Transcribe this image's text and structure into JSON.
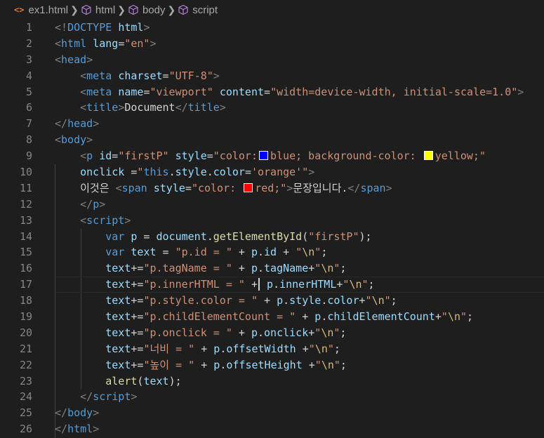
{
  "breadcrumb": {
    "file_icon": "<>",
    "file": "ex1.html",
    "items": [
      "html",
      "body",
      "script"
    ]
  },
  "editor": {
    "language": "html",
    "cursor_line": 17,
    "lines": [
      {
        "n": "1",
        "tokens": [
          [
            "punct",
            "<!"
          ],
          [
            "tag",
            "DOCTYPE"
          ],
          [
            "text",
            " "
          ],
          [
            "attr",
            "html"
          ],
          [
            "punct",
            ">"
          ]
        ]
      },
      {
        "n": "2",
        "tokens": [
          [
            "punct",
            "<"
          ],
          [
            "tag",
            "html"
          ],
          [
            "text",
            " "
          ],
          [
            "attr",
            "lang"
          ],
          [
            "text",
            "="
          ],
          [
            "str",
            "\"en\""
          ],
          [
            "punct",
            ">"
          ]
        ]
      },
      {
        "n": "3",
        "tokens": [
          [
            "punct",
            "<"
          ],
          [
            "tag",
            "head"
          ],
          [
            "punct",
            ">"
          ]
        ]
      },
      {
        "n": "4",
        "tokens": [
          [
            "text",
            "    "
          ],
          [
            "punct",
            "<"
          ],
          [
            "tag",
            "meta"
          ],
          [
            "text",
            " "
          ],
          [
            "attr",
            "charset"
          ],
          [
            "text",
            "="
          ],
          [
            "str",
            "\"UTF-8\""
          ],
          [
            "punct",
            ">"
          ]
        ]
      },
      {
        "n": "5",
        "tokens": [
          [
            "text",
            "    "
          ],
          [
            "punct",
            "<"
          ],
          [
            "tag",
            "meta"
          ],
          [
            "text",
            " "
          ],
          [
            "attr",
            "name"
          ],
          [
            "text",
            "="
          ],
          [
            "str",
            "\"viewport\""
          ],
          [
            "text",
            " "
          ],
          [
            "attr",
            "content"
          ],
          [
            "text",
            "="
          ],
          [
            "str",
            "\"width=device-width, initial-scale=1.0\""
          ],
          [
            "punct",
            ">"
          ]
        ]
      },
      {
        "n": "6",
        "tokens": [
          [
            "text",
            "    "
          ],
          [
            "punct",
            "<"
          ],
          [
            "tag",
            "title"
          ],
          [
            "punct",
            ">"
          ],
          [
            "text",
            "Document"
          ],
          [
            "punct",
            "</"
          ],
          [
            "tag",
            "title"
          ],
          [
            "punct",
            ">"
          ]
        ]
      },
      {
        "n": "7",
        "tokens": [
          [
            "punct",
            "</"
          ],
          [
            "tag",
            "head"
          ],
          [
            "punct",
            ">"
          ]
        ]
      },
      {
        "n": "8",
        "tokens": [
          [
            "punct",
            "<"
          ],
          [
            "tag",
            "body"
          ],
          [
            "punct",
            ">"
          ]
        ]
      },
      {
        "n": "9",
        "tokens": [
          [
            "text",
            "    "
          ],
          [
            "punct",
            "<"
          ],
          [
            "tag",
            "p"
          ],
          [
            "text",
            " "
          ],
          [
            "attr",
            "id"
          ],
          [
            "text",
            "="
          ],
          [
            "str",
            "\"firstP\""
          ],
          [
            "text",
            " "
          ],
          [
            "attr",
            "style"
          ],
          [
            "text",
            "="
          ],
          [
            "str",
            "\"color:"
          ],
          [
            "swatch",
            "#0000ff"
          ],
          [
            "str",
            "blue; background-color: "
          ],
          [
            "swatch",
            "#ffff00"
          ],
          [
            "str",
            "yellow;\""
          ]
        ]
      },
      {
        "n": "10",
        "tokens": [
          [
            "text",
            "    "
          ],
          [
            "attr",
            "onclick"
          ],
          [
            "text",
            " ="
          ],
          [
            "str",
            "\""
          ],
          [
            "kw",
            "this"
          ],
          [
            "text",
            "."
          ],
          [
            "var",
            "style"
          ],
          [
            "text",
            "."
          ],
          [
            "var",
            "color"
          ],
          [
            "text",
            "="
          ],
          [
            "str",
            "'orange'"
          ],
          [
            "str",
            "\""
          ],
          [
            "punct",
            ">"
          ]
        ]
      },
      {
        "n": "11",
        "tokens": [
          [
            "text",
            "    이것은 "
          ],
          [
            "punct",
            "<"
          ],
          [
            "tag",
            "span"
          ],
          [
            "text",
            " "
          ],
          [
            "attr",
            "style"
          ],
          [
            "text",
            "="
          ],
          [
            "str",
            "\"color: "
          ],
          [
            "swatch",
            "#ff0000"
          ],
          [
            "str",
            "red;\""
          ],
          [
            "punct",
            ">"
          ],
          [
            "text",
            "문장입니다."
          ],
          [
            "punct",
            "</"
          ],
          [
            "tag",
            "span"
          ],
          [
            "punct",
            ">"
          ]
        ]
      },
      {
        "n": "12",
        "tokens": [
          [
            "text",
            "    "
          ],
          [
            "punct",
            "</"
          ],
          [
            "tag",
            "p"
          ],
          [
            "punct",
            ">"
          ]
        ]
      },
      {
        "n": "13",
        "tokens": [
          [
            "text",
            "    "
          ],
          [
            "punct",
            "<"
          ],
          [
            "tag",
            "script"
          ],
          [
            "punct",
            ">"
          ]
        ]
      },
      {
        "n": "14",
        "tokens": [
          [
            "text",
            "        "
          ],
          [
            "kw",
            "var"
          ],
          [
            "text",
            " "
          ],
          [
            "var",
            "p"
          ],
          [
            "text",
            " = "
          ],
          [
            "var",
            "document"
          ],
          [
            "text",
            "."
          ],
          [
            "fn",
            "getElementById"
          ],
          [
            "text",
            "("
          ],
          [
            "str",
            "\"firstP\""
          ],
          [
            "text",
            ");"
          ]
        ]
      },
      {
        "n": "15",
        "tokens": [
          [
            "text",
            "        "
          ],
          [
            "kw",
            "var"
          ],
          [
            "text",
            " "
          ],
          [
            "var",
            "text"
          ],
          [
            "text",
            " = "
          ],
          [
            "str",
            "\"p.id = \""
          ],
          [
            "text",
            " + "
          ],
          [
            "var",
            "p"
          ],
          [
            "text",
            "."
          ],
          [
            "var",
            "id"
          ],
          [
            "text",
            " + "
          ],
          [
            "str",
            "\""
          ],
          [
            "esc",
            "\\n"
          ],
          [
            "str",
            "\""
          ],
          [
            "text",
            ";"
          ]
        ]
      },
      {
        "n": "16",
        "tokens": [
          [
            "text",
            "        "
          ],
          [
            "var",
            "text"
          ],
          [
            "text",
            "+="
          ],
          [
            "str",
            "\"p.tagName = \""
          ],
          [
            "text",
            " + "
          ],
          [
            "var",
            "p"
          ],
          [
            "text",
            "."
          ],
          [
            "var",
            "tagName"
          ],
          [
            "text",
            "+"
          ],
          [
            "str",
            "\""
          ],
          [
            "esc",
            "\\n"
          ],
          [
            "str",
            "\""
          ],
          [
            "text",
            ";"
          ]
        ]
      },
      {
        "n": "17",
        "tokens": [
          [
            "text",
            "        "
          ],
          [
            "var",
            "text"
          ],
          [
            "text",
            "+="
          ],
          [
            "str",
            "\"p.innerHTML = \""
          ],
          [
            "text",
            " +"
          ],
          [
            "cursor",
            ""
          ],
          [
            "text",
            " "
          ],
          [
            "var",
            "p"
          ],
          [
            "text",
            "."
          ],
          [
            "var",
            "innerHTML"
          ],
          [
            "text",
            "+"
          ],
          [
            "str",
            "\""
          ],
          [
            "esc",
            "\\n"
          ],
          [
            "str",
            "\""
          ],
          [
            "text",
            ";"
          ]
        ]
      },
      {
        "n": "18",
        "tokens": [
          [
            "text",
            "        "
          ],
          [
            "var",
            "text"
          ],
          [
            "text",
            "+="
          ],
          [
            "str",
            "\"p.style.color = \""
          ],
          [
            "text",
            " + "
          ],
          [
            "var",
            "p"
          ],
          [
            "text",
            "."
          ],
          [
            "var",
            "style"
          ],
          [
            "text",
            "."
          ],
          [
            "var",
            "color"
          ],
          [
            "text",
            "+"
          ],
          [
            "str",
            "\""
          ],
          [
            "esc",
            "\\n"
          ],
          [
            "str",
            "\""
          ],
          [
            "text",
            ";"
          ]
        ]
      },
      {
        "n": "19",
        "tokens": [
          [
            "text",
            "        "
          ],
          [
            "var",
            "text"
          ],
          [
            "text",
            "+="
          ],
          [
            "str",
            "\"p.childElementCount = \""
          ],
          [
            "text",
            " + "
          ],
          [
            "var",
            "p"
          ],
          [
            "text",
            "."
          ],
          [
            "var",
            "childElementCount"
          ],
          [
            "text",
            "+"
          ],
          [
            "str",
            "\""
          ],
          [
            "esc",
            "\\n"
          ],
          [
            "str",
            "\""
          ],
          [
            "text",
            ";"
          ]
        ]
      },
      {
        "n": "20",
        "tokens": [
          [
            "text",
            "        "
          ],
          [
            "var",
            "text"
          ],
          [
            "text",
            "+="
          ],
          [
            "str",
            "\"p.onclick = \""
          ],
          [
            "text",
            " + "
          ],
          [
            "var",
            "p"
          ],
          [
            "text",
            "."
          ],
          [
            "var",
            "onclick"
          ],
          [
            "text",
            "+"
          ],
          [
            "str",
            "\""
          ],
          [
            "esc",
            "\\n"
          ],
          [
            "str",
            "\""
          ],
          [
            "text",
            ";"
          ]
        ]
      },
      {
        "n": "21",
        "tokens": [
          [
            "text",
            "        "
          ],
          [
            "var",
            "text"
          ],
          [
            "text",
            "+="
          ],
          [
            "str",
            "\"너비 = \""
          ],
          [
            "text",
            " + "
          ],
          [
            "var",
            "p"
          ],
          [
            "text",
            "."
          ],
          [
            "var",
            "offsetWidth"
          ],
          [
            "text",
            " +"
          ],
          [
            "str",
            "\""
          ],
          [
            "esc",
            "\\n"
          ],
          [
            "str",
            "\""
          ],
          [
            "text",
            ";"
          ]
        ]
      },
      {
        "n": "22",
        "tokens": [
          [
            "text",
            "        "
          ],
          [
            "var",
            "text"
          ],
          [
            "text",
            "+="
          ],
          [
            "str",
            "\"높이 = \""
          ],
          [
            "text",
            " + "
          ],
          [
            "var",
            "p"
          ],
          [
            "text",
            "."
          ],
          [
            "var",
            "offsetHeight"
          ],
          [
            "text",
            " +"
          ],
          [
            "str",
            "\""
          ],
          [
            "esc",
            "\\n"
          ],
          [
            "str",
            "\""
          ],
          [
            "text",
            ";"
          ]
        ]
      },
      {
        "n": "23",
        "tokens": [
          [
            "text",
            "        "
          ],
          [
            "fn",
            "alert"
          ],
          [
            "text",
            "("
          ],
          [
            "var",
            "text"
          ],
          [
            "text",
            ");"
          ]
        ]
      },
      {
        "n": "24",
        "tokens": [
          [
            "text",
            "    "
          ],
          [
            "punct",
            "</"
          ],
          [
            "tag",
            "script"
          ],
          [
            "punct",
            ">"
          ]
        ]
      },
      {
        "n": "25",
        "tokens": [
          [
            "punct",
            "</"
          ],
          [
            "tag",
            "body"
          ],
          [
            "punct",
            ">"
          ]
        ]
      },
      {
        "n": "26",
        "tokens": [
          [
            "punct",
            "</"
          ],
          [
            "tag",
            "html"
          ],
          [
            "punct",
            ">"
          ]
        ]
      }
    ]
  }
}
